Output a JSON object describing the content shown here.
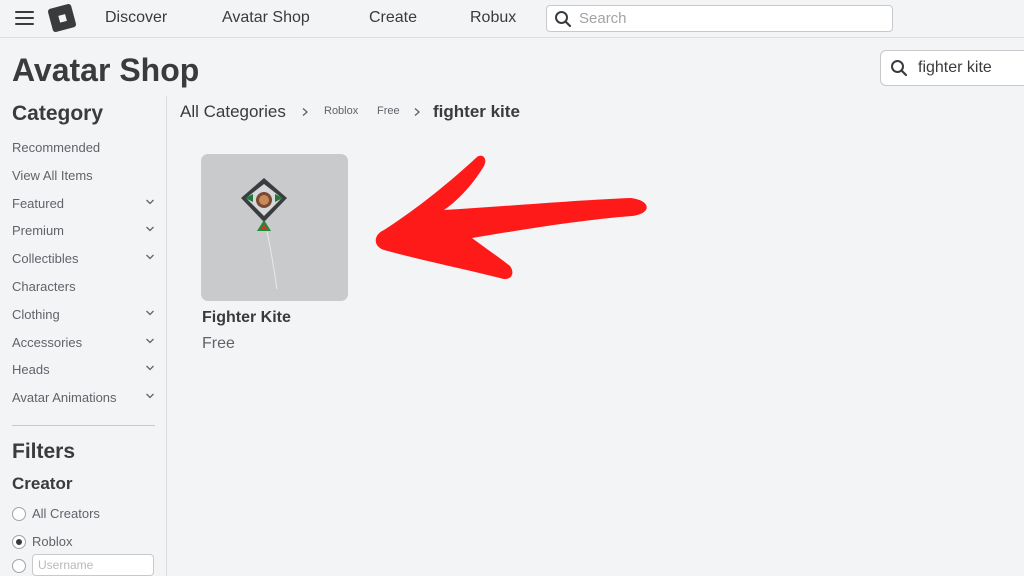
{
  "topnav": {
    "links": [
      "Discover",
      "Avatar Shop",
      "Create",
      "Robux"
    ],
    "search_placeholder": "Search"
  },
  "page": {
    "title": "Avatar Shop",
    "search_value": "fighter kite"
  },
  "sidebar": {
    "category_heading": "Category",
    "items": [
      {
        "label": "Recommended",
        "has_chevron": false
      },
      {
        "label": "View All Items",
        "has_chevron": false
      },
      {
        "label": "Featured",
        "has_chevron": true
      },
      {
        "label": "Premium",
        "has_chevron": true
      },
      {
        "label": "Collectibles",
        "has_chevron": true
      },
      {
        "label": "Characters",
        "has_chevron": false
      },
      {
        "label": "Clothing",
        "has_chevron": true
      },
      {
        "label": "Accessories",
        "has_chevron": true
      },
      {
        "label": "Heads",
        "has_chevron": true
      },
      {
        "label": "Avatar Animations",
        "has_chevron": true
      }
    ],
    "filters_heading": "Filters",
    "creator_heading": "Creator",
    "creator_options": [
      {
        "label": "All Creators",
        "checked": false
      },
      {
        "label": "Roblox",
        "checked": true
      }
    ],
    "username_placeholder": "Username"
  },
  "breadcrumb": {
    "root": "All Categories",
    "level1": "Roblox",
    "level2": "Free",
    "current": "fighter kite"
  },
  "results": [
    {
      "name": "Fighter Kite",
      "price": "Free"
    }
  ],
  "colors": {
    "background": "#f2f4f5",
    "text": "#393b3d",
    "annotation_arrow": "#ff1a1a",
    "thumbnail_bg": "#c9cacc"
  },
  "icons": {
    "menu": "hamburger-icon",
    "logo": "roblox-logo",
    "search": "search-icon",
    "chevron": "chevron-down-icon",
    "separator": "chevron-right-icon"
  }
}
